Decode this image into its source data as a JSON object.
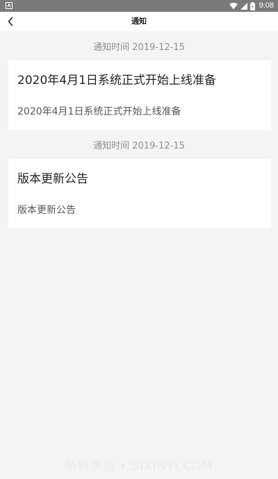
{
  "status_bar": {
    "time": "9:08"
  },
  "header": {
    "title": "通知"
  },
  "notices": [
    {
      "time": "通知时间 2019-12-15",
      "title": "2020年4月1日系统正式开始上线准备",
      "body": "2020年4月1日系统正式开始上线准备"
    },
    {
      "time": "通知时间 2019-12-15",
      "title": "版本更新公告",
      "body": "版本更新公告"
    }
  ],
  "watermark": "新新手游 • SIXINYI.COM",
  "icons": {
    "back": "chevron-left-icon",
    "wifi": "wifi-icon",
    "signal": "signal-icon",
    "battery": "battery-icon",
    "notification": "app-notification-icon"
  },
  "colors": {
    "status_bar": "#7a7a7a",
    "background": "#f4f4f4",
    "card": "#ffffff",
    "muted_text": "#8e8e8e"
  }
}
